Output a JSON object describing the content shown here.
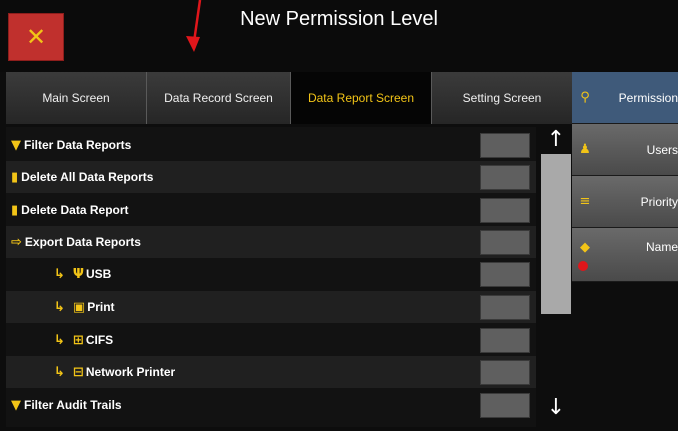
{
  "header": {
    "title": "New Permission Level",
    "close_label": "✕"
  },
  "tabs": [
    {
      "label": "Main Screen",
      "active": false
    },
    {
      "label": "Data Record Screen",
      "active": false
    },
    {
      "label": "Data Report Screen",
      "active": true
    },
    {
      "label": "Setting Screen",
      "active": false
    }
  ],
  "rows": [
    {
      "label": "Filter Data Reports",
      "icon": "filter-icon"
    },
    {
      "label": "Delete All Data Reports",
      "icon": "trash-icon"
    },
    {
      "label": "Delete Data Report",
      "icon": "trash-icon"
    },
    {
      "label": "Export Data Reports",
      "icon": "export-icon"
    },
    {
      "label": "USB",
      "icon": "usb-icon"
    },
    {
      "label": "Print",
      "icon": "printer-icon"
    },
    {
      "label": "CIFS",
      "icon": "network-share-icon"
    },
    {
      "label": "Network Printer",
      "icon": "network-printer-icon"
    },
    {
      "label": "Filter Audit Trails",
      "icon": "filter-icon"
    }
  ],
  "scroll": {
    "up": "↑",
    "down": "↓"
  },
  "side": {
    "permission": "Permission",
    "users": "Users",
    "priority": "Priority",
    "name": "Name"
  },
  "colors": {
    "accent": "#f2c417",
    "close_bg": "#c0302d",
    "side_active": "#3f5a7a",
    "annotation": "#e0161b"
  }
}
